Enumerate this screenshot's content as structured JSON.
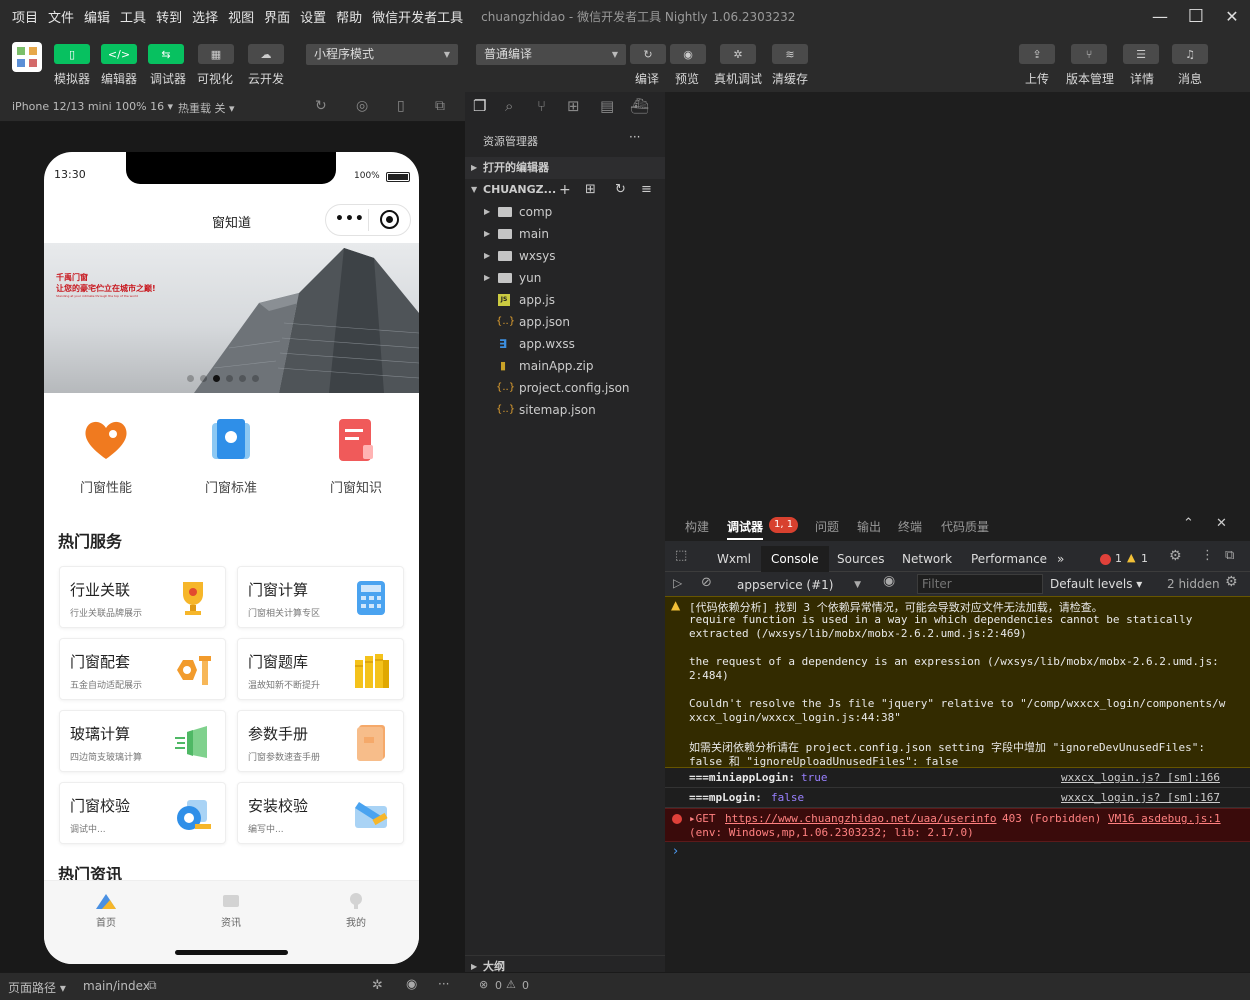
{
  "menubar": {
    "items": [
      "项目",
      "文件",
      "编辑",
      "工具",
      "转到",
      "选择",
      "视图",
      "界面",
      "设置",
      "帮助",
      "微信开发者工具"
    ],
    "title": "chuangzhidao - 微信开发者工具 Nightly 1.06.2303232",
    "minimize": "—",
    "maximize": "☐",
    "close": "✕"
  },
  "toolbar": {
    "simulator": "模拟器",
    "editor": "编辑器",
    "debugger": "调试器",
    "visual": "可视化",
    "cloud": "云开发",
    "mode_select": "小程序模式",
    "compile_select": "普通编译",
    "compile": "编译",
    "preview": "预览",
    "remote_debug": "真机调试",
    "clear_cache": "清缓存",
    "upload": "上传",
    "version": "版本管理",
    "details": "详情",
    "messages": "消息",
    "editor_icon": "</>"
  },
  "simbar": {
    "device": "iPhone 12/13 mini 100% 16 ▾",
    "hotreload": "热重载 关 ▾"
  },
  "phone": {
    "time": "13:30",
    "battery": "100%",
    "nav_title": "窗知道",
    "banner_line1": "千禹门窗",
    "banner_line2": "让您的豪宅伫立在城市之巅!",
    "banner_line3": "Standing at your intimate through the top of the world",
    "quick": [
      "门窗性能",
      "门窗标准",
      "门窗知识"
    ],
    "hot_services_title": "热门服务",
    "cards": [
      {
        "title": "行业关联",
        "sub": "行业关联品牌展示"
      },
      {
        "title": "门窗计算",
        "sub": "门窗相关计算专区"
      },
      {
        "title": "门窗配套",
        "sub": "五金自动适配展示"
      },
      {
        "title": "门窗题库",
        "sub": "温故知新不断提升"
      },
      {
        "title": "玻璃计算",
        "sub": "四边简支玻璃计算"
      },
      {
        "title": "参数手册",
        "sub": "门窗参数速查手册"
      },
      {
        "title": "门窗校验",
        "sub": "调试中..."
      },
      {
        "title": "安装校验",
        "sub": "编写中..."
      }
    ],
    "hot_news_title": "热门资讯",
    "tabs": [
      "首页",
      "资讯",
      "我的"
    ],
    "active_tab_color": "#4a90e2"
  },
  "explorer": {
    "title": "资源管理器",
    "more": "···",
    "open_editors": "打开的编辑器",
    "project": "CHUANGZ...",
    "folders": [
      "comp",
      "main",
      "wxsys",
      "yun"
    ],
    "files": [
      {
        "name": "app.js",
        "icon": "js-file-icon",
        "badge": "JS",
        "color": "#cbcb41"
      },
      {
        "name": "app.json",
        "icon": "json-file-icon",
        "badge": "{..}",
        "color": "#e0a030"
      },
      {
        "name": "app.wxss",
        "icon": "wxss-file-icon",
        "badge": "∃",
        "color": "#3d8fe0"
      },
      {
        "name": "mainApp.zip",
        "icon": "zip-file-icon",
        "badge": "▮",
        "color": "#c9a227"
      },
      {
        "name": "project.config.json",
        "icon": "json-file-icon",
        "badge": "{..}",
        "color": "#e0a030"
      },
      {
        "name": "sitemap.json",
        "icon": "json-file-icon",
        "badge": "{..}",
        "color": "#e0a030"
      }
    ],
    "outline": "大纲",
    "problems_count": "0",
    "warnings_count": "0"
  },
  "devtools": {
    "top_tabs": [
      "构建",
      "调试器",
      "问题",
      "输出",
      "终端",
      "代码质量"
    ],
    "debugger_badge": "1, 1",
    "panels": [
      "Wxml",
      "Console",
      "Sources",
      "Network",
      "Performance"
    ],
    "more_panels": "»",
    "error_count": "1",
    "warn_count": "1",
    "context": "appservice (#1)",
    "filter_placeholder": "Filter",
    "levels": "Default levels ▾",
    "hidden": "2 hidden",
    "warning_lines": [
      "[代码依赖分析] 找到 3 个依赖异常情况，可能会导致对应文件无法加载，请检查。",
      "require function is used in a way in which dependencies cannot be statically",
      "extracted (/wxsys/lib/mobx/mobx-2.6.2.umd.js:2:469)",
      "",
      "the request of a dependency is an expression (/wxsys/lib/mobx/mobx-2.6.2.umd.js:",
      "2:484)",
      "",
      "Couldn't resolve the Js file \"jquery\" relative to \"/comp/wxxcx_login/components/w",
      "xxcx_login/wxxcx_login.js:44:38\"",
      "",
      "如需关闭依赖分析请在 project.config.json setting 字段中增加 \"ignoreDevUnusedFiles\":",
      "false 和 \"ignoreUploadUnusedFiles\": false"
    ],
    "log1_key": "===miniappLogin:",
    "log1_val": "true",
    "log1_src": "wxxcx_login.js? [sm]:166",
    "log2_key": "===mpLogin:",
    "log2_val": "false",
    "log2_src": "wxxcx_login.js? [sm]:167",
    "err_method": "▸GET",
    "err_url": "https://www.chuangzhidao.net/uaa/userinfo",
    "err_status": "403 (Forbidden)",
    "err_src": "VM16 asdebug.js:1",
    "err_env": "(env: Windows,mp,1.06.2303232; lib: 2.17.0)",
    "prompt": "›"
  },
  "statusbar": {
    "page_path_label": "页面路径 ▾",
    "page_path": "main/index"
  },
  "colors": {
    "accent_green": "#07c160",
    "warning_bg": "#332b00",
    "error_bg": "#3a0b0b",
    "link_color": "#7ab7ff"
  }
}
